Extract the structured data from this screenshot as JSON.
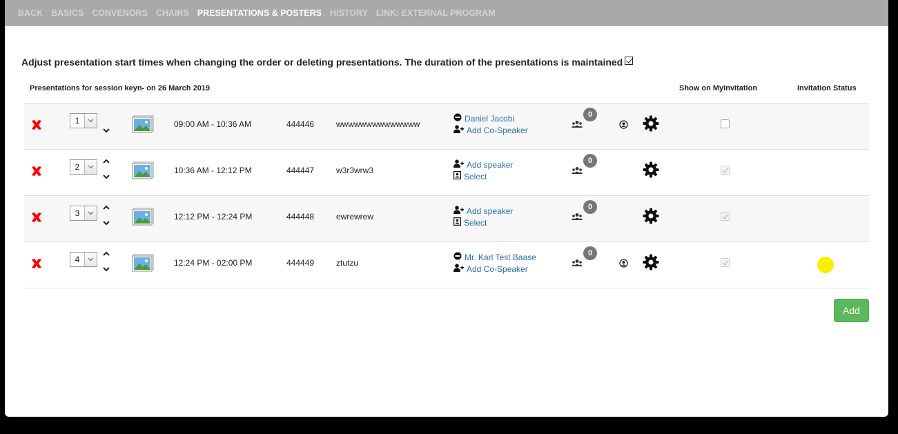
{
  "nav": {
    "items": [
      {
        "label": "BACK",
        "active": false
      },
      {
        "label": "BASICS",
        "active": false
      },
      {
        "label": "CONVENORS",
        "active": false
      },
      {
        "label": "CHAIRS",
        "active": false
      },
      {
        "label": "PRESENTATIONS & POSTERS",
        "active": true
      },
      {
        "label": "HISTORY",
        "active": false
      },
      {
        "label": "LINK: EXTERNAL PROGRAM",
        "active": false
      }
    ]
  },
  "notice": {
    "text": "Adjust presentation start times when changing the order or deleting presentations. The duration of the presentations is maintained",
    "checked": true
  },
  "table": {
    "caption": "Presentations for session keyn- on 26 March 2019",
    "col_show": "Show on MyInvitation",
    "col_status": "Invitation Status"
  },
  "rows": [
    {
      "order": "1",
      "time": "09:00 AM - 10:36 AM",
      "code": "444446",
      "title": "wwwwwwwwwwwwww",
      "link1": "Daniel Jacobi",
      "link2": "Add Co-Speaker",
      "count": "0",
      "show_checked": false
    },
    {
      "order": "2",
      "time": "10:36 AM - 12:12 PM",
      "code": "444447",
      "title": "w3r3wrw3",
      "link1": "Add speaker",
      "link2": "Select",
      "count": "0",
      "show_checked": true
    },
    {
      "order": "3",
      "time": "12:12 PM - 12:24 PM",
      "code": "444448",
      "title": "ewrewrew",
      "link1": "Add speaker",
      "link2": "Select",
      "count": "0",
      "show_checked": true
    },
    {
      "order": "4",
      "time": "12:24 PM - 02:00 PM",
      "code": "444449",
      "title": "ztutzu",
      "link1": "Mr. Karl Test Baase",
      "link2": "Add Co-Speaker",
      "count": "0",
      "show_checked": true
    }
  ],
  "add_button": "Add",
  "colors": {
    "delete": "#ff0000",
    "link": "#2a6fb0",
    "add": "#5cb85c",
    "status_pending": "#f7f000"
  }
}
